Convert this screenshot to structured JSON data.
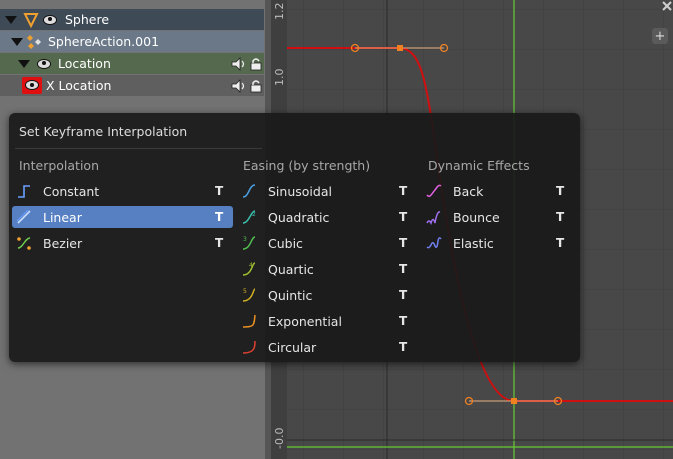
{
  "channels": {
    "object": {
      "label": "Sphere",
      "icon": "triangle-down-icon"
    },
    "action": {
      "label": "SphereAction.001"
    },
    "group": {
      "label": "Location"
    },
    "channel": {
      "label": "X Location"
    }
  },
  "graph": {
    "ruler_ticks": [
      "1.2",
      "1.0",
      "-0.0"
    ]
  },
  "menu": {
    "title": "Set Keyframe Interpolation",
    "columns": [
      {
        "heading": "Interpolation",
        "items": [
          {
            "label": "Constant",
            "shortcut": "T",
            "icon": "constant-curve-icon",
            "color": "#6aa0ff",
            "active": false
          },
          {
            "label": "Linear",
            "shortcut": "T",
            "icon": "linear-curve-icon",
            "color": "#6aa0ff",
            "active": true
          },
          {
            "label": "Bezier",
            "shortcut": "T",
            "icon": "bezier-curve-icon",
            "color": "#f0a030",
            "active": false
          }
        ]
      },
      {
        "heading": "Easing (by strength)",
        "items": [
          {
            "label": "Sinusoidal",
            "shortcut": "T",
            "icon": "sinusoidal-curve-icon",
            "color": "#4aa0e0"
          },
          {
            "label": "Quadratic",
            "shortcut": "T",
            "icon": "quadratic-curve-icon",
            "color": "#3cc0b0"
          },
          {
            "label": "Cubic",
            "shortcut": "T",
            "icon": "cubic-curve-icon",
            "color": "#50c050"
          },
          {
            "label": "Quartic",
            "shortcut": "T",
            "icon": "quartic-curve-icon",
            "color": "#a0c030"
          },
          {
            "label": "Quintic",
            "shortcut": "T",
            "icon": "quintic-curve-icon",
            "color": "#d0b020"
          },
          {
            "label": "Exponential",
            "shortcut": "T",
            "icon": "exponential-curve-icon",
            "color": "#e89020"
          },
          {
            "label": "Circular",
            "shortcut": "T",
            "icon": "circular-curve-icon",
            "color": "#e04030"
          }
        ]
      },
      {
        "heading": "Dynamic Effects",
        "items": [
          {
            "label": "Back",
            "shortcut": "T",
            "icon": "back-curve-icon",
            "color": "#e060e0"
          },
          {
            "label": "Bounce",
            "shortcut": "T",
            "icon": "bounce-curve-icon",
            "color": "#a070f0"
          },
          {
            "label": "Elastic",
            "shortcut": "T",
            "icon": "elastic-curve-icon",
            "color": "#7080f0"
          }
        ]
      }
    ]
  }
}
